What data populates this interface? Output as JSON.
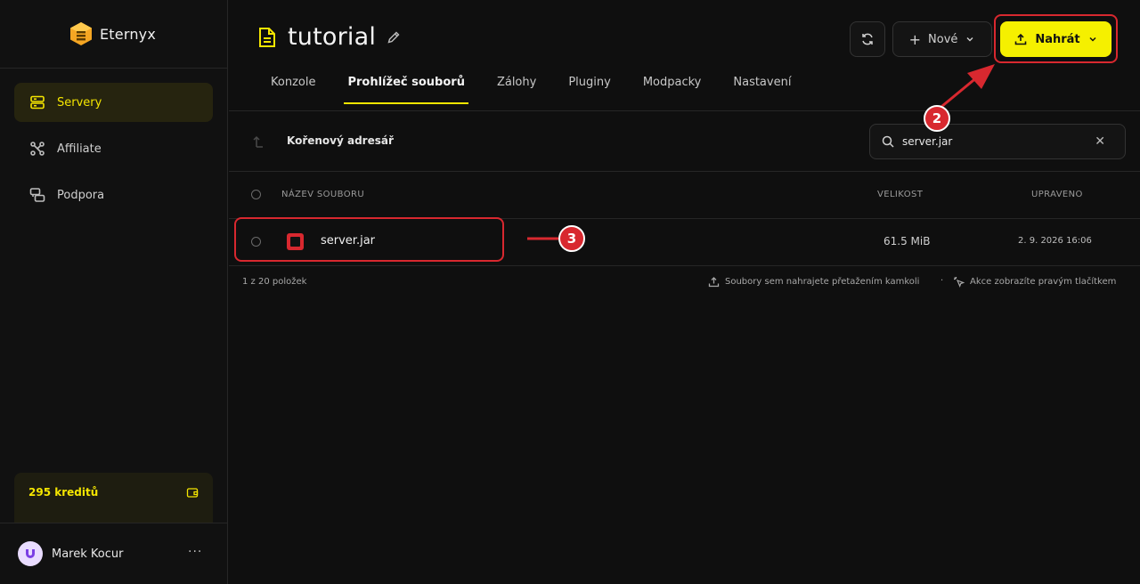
{
  "app": {
    "name": "Eternyx"
  },
  "sidebar": {
    "items": [
      {
        "label": "Servery",
        "icon": "server-icon",
        "active": true
      },
      {
        "label": "Affiliate",
        "icon": "affiliate-icon",
        "active": false
      },
      {
        "label": "Podpora",
        "icon": "support-icon",
        "active": false
      }
    ],
    "credits_label": "295 kreditů",
    "user_name": "Marek Kocur",
    "user_more": "···"
  },
  "header": {
    "title": "tutorial",
    "new_label": "Nové",
    "upload_label": "Nahrát"
  },
  "tabs": [
    {
      "label": "Konzole",
      "active": false
    },
    {
      "label": "Prohlížeč souborů",
      "active": true
    },
    {
      "label": "Zálohy",
      "active": false
    },
    {
      "label": "Pluginy",
      "active": false
    },
    {
      "label": "Modpacky",
      "active": false
    },
    {
      "label": "Nastavení",
      "active": false
    }
  ],
  "browser": {
    "path": "Kořenový adresář",
    "search_value": "server.jar",
    "search_clear": "✕",
    "columns": {
      "name": "NÁZEV SOUBORU",
      "size": "VELIKOST",
      "modified": "UPRAVENO"
    },
    "rows": [
      {
        "name": "server.jar",
        "size": "61.5 MiB",
        "modified": "2. 9. 2026 16:06"
      }
    ],
    "count_text": "1 z 20 položek",
    "hint_upload": "Soubory sem nahrajete přetažením kamkoli",
    "hint_separator": "·",
    "hint_actions": "Akce zobrazíte pravým tlačítkem"
  },
  "annotations": {
    "marker_2": "2",
    "marker_3": "3"
  },
  "colors": {
    "accent": "#f5f000",
    "annotation": "#d8282f",
    "background": "#0f0f0f"
  }
}
